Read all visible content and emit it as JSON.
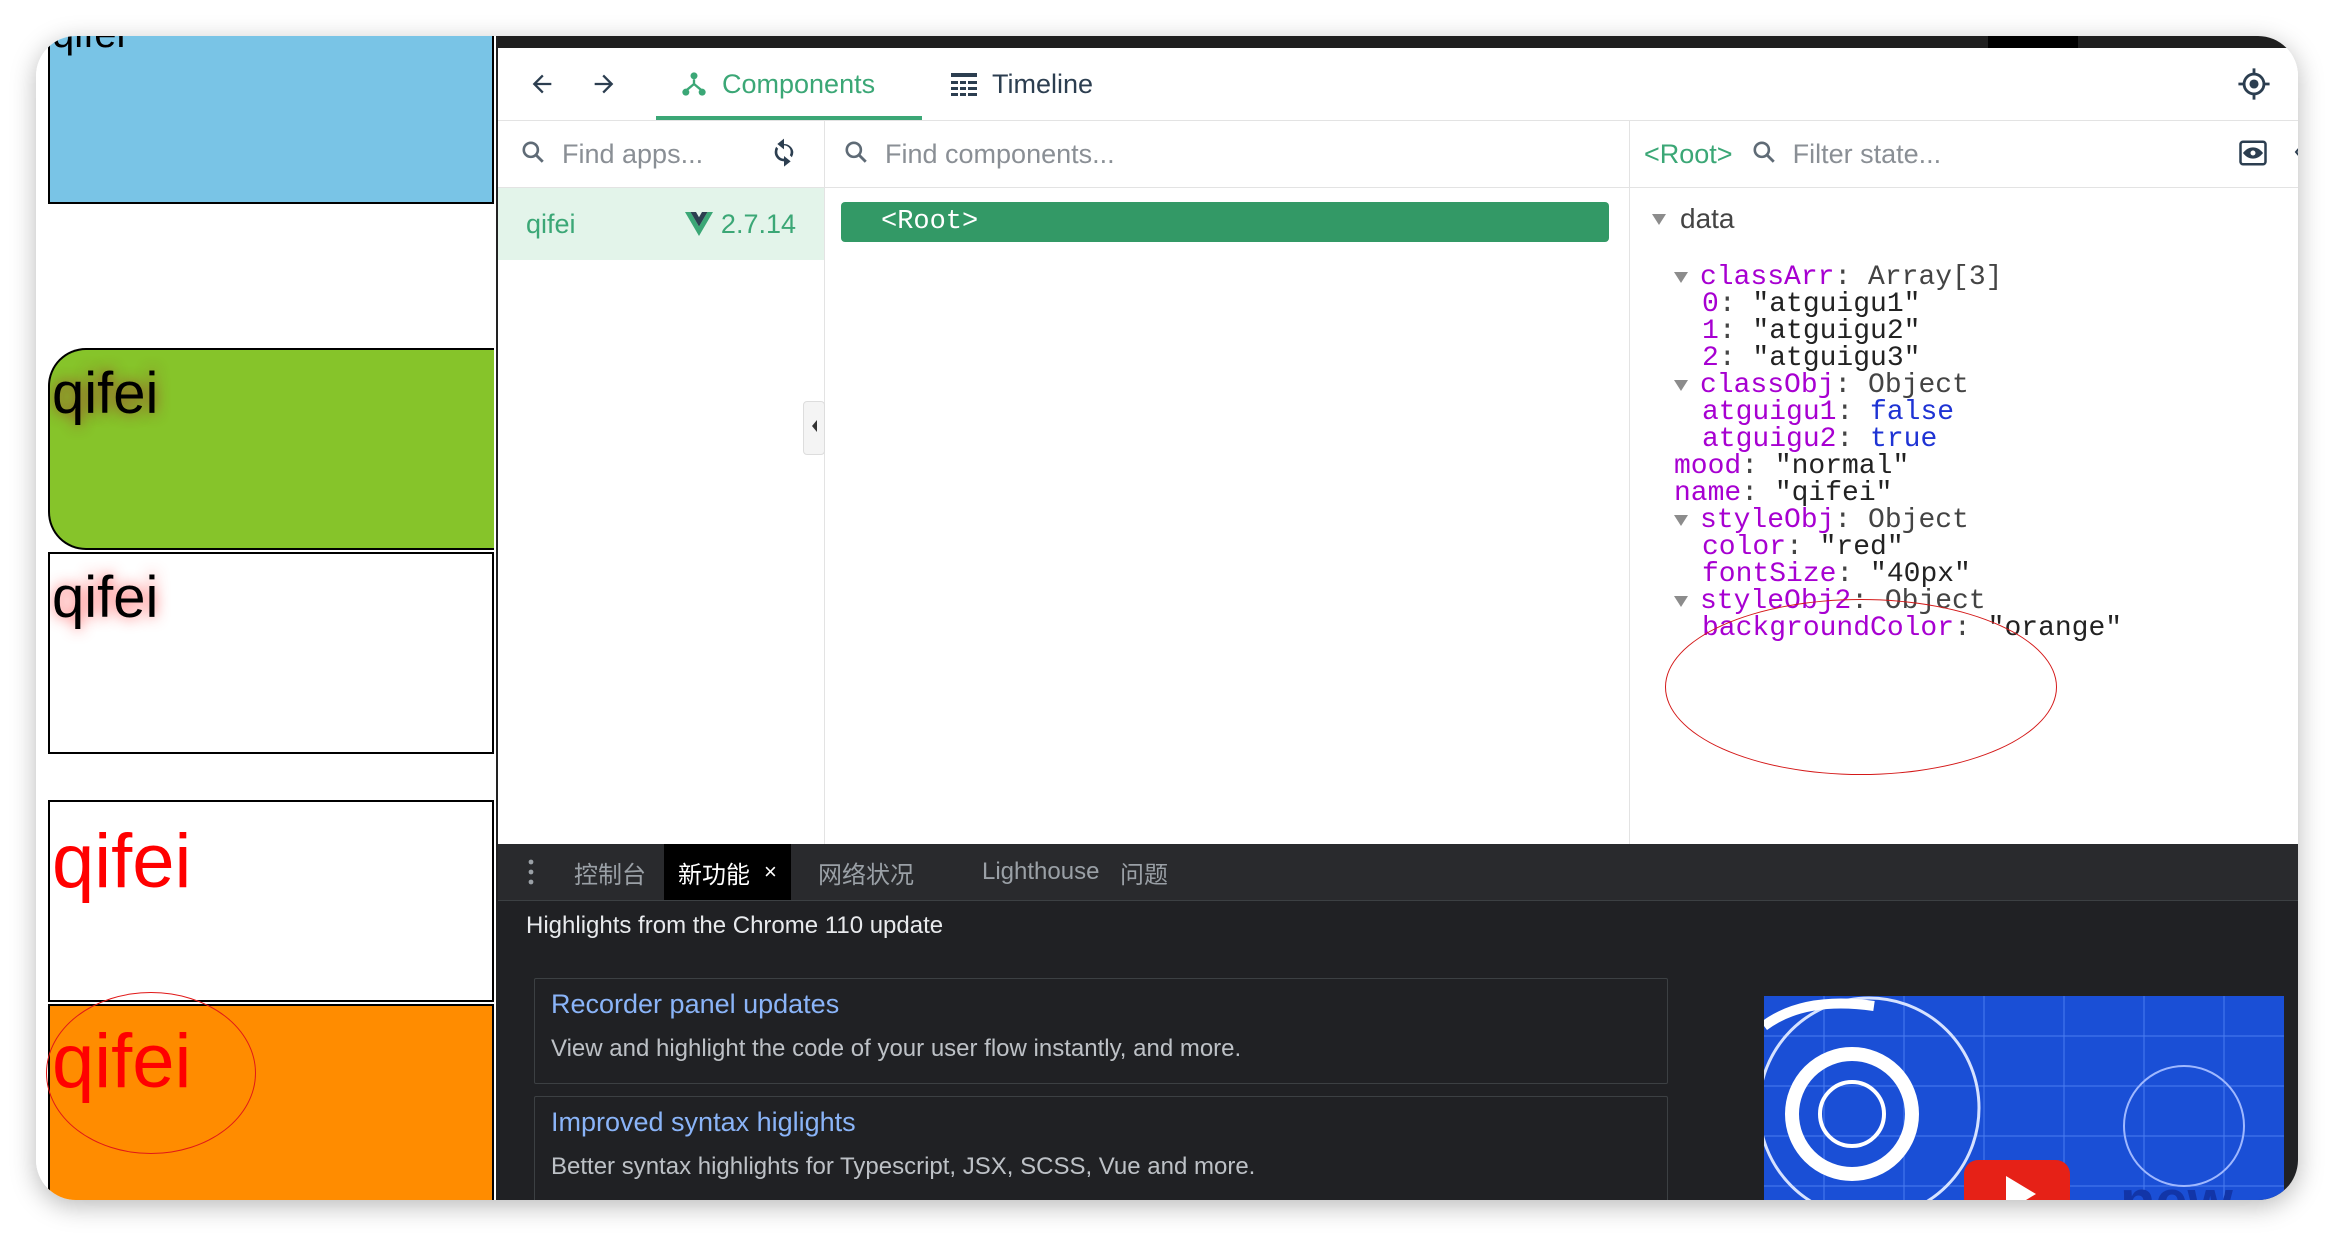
{
  "page": {
    "box1_text": "qifei",
    "box2_text": "qifei",
    "box3_text": "qifei",
    "box4_text": "qifei",
    "box5_text": "qifei",
    "colors": {
      "box1": "#79c4e6",
      "box2": "#86c42a",
      "box5": "#ff8c00",
      "text_red": "#ff0000"
    }
  },
  "devtools": {
    "nav": {
      "back_icon": "arrow-left-icon",
      "forward_icon": "arrow-right-icon",
      "tabs": [
        {
          "label": "Components",
          "icon": "components-tree-icon",
          "active": true
        },
        {
          "label": "Timeline",
          "icon": "timeline-icon",
          "active": false
        }
      ],
      "inspect_icon": "target-icon"
    },
    "apps": {
      "search_placeholder": "Find apps...",
      "refresh_icon": "refresh-icon",
      "list": [
        {
          "name": "qifei",
          "version": "2.7.14",
          "logo": "vue-logo-icon"
        }
      ]
    },
    "components": {
      "search_placeholder": "Find components...",
      "tree": [
        {
          "label": "<Root>",
          "selected": true
        }
      ]
    },
    "state": {
      "selected_tag": "<Root>",
      "filter_placeholder": "Filter state...",
      "section": "data",
      "fields": {
        "classArr": {
          "key": "classArr",
          "type": "Array[3]",
          "items": [
            {
              "index": "0",
              "value": "\"atguigu1\""
            },
            {
              "index": "1",
              "value": "\"atguigu2\""
            },
            {
              "index": "2",
              "value": "\"atguigu3\""
            }
          ]
        },
        "classObj": {
          "key": "classObj",
          "type": "Object",
          "entries": [
            {
              "key": "atguigu1",
              "value": "false"
            },
            {
              "key": "atguigu2",
              "value": "true"
            }
          ]
        },
        "mood": {
          "key": "mood",
          "value": "\"normal\""
        },
        "name": {
          "key": "name",
          "value": "\"qifei\""
        },
        "styleObj": {
          "key": "styleObj",
          "type": "Object",
          "entries": [
            {
              "key": "color",
              "value": "\"red\""
            },
            {
              "key": "fontSize",
              "value": "\"40px\""
            }
          ]
        },
        "styleObj2": {
          "key": "styleObj2",
          "type": "Object",
          "entries": [
            {
              "key": "backgroundColor",
              "value": "\"orange\""
            }
          ]
        }
      }
    },
    "colors": {
      "accent": "#3ba776",
      "key": "#a700d1",
      "bool": "#1e33d4"
    }
  },
  "drawer": {
    "tabs": [
      {
        "label": "控制台",
        "active": false
      },
      {
        "label": "新功能",
        "active": true
      },
      {
        "label": "网络状况",
        "active": false
      },
      {
        "label": "Lighthouse",
        "active": false
      },
      {
        "label": "问题",
        "active": false
      }
    ],
    "close_glyph": "×",
    "headline": "Highlights from the Chrome 110 update",
    "cards": [
      {
        "title": "Recorder panel updates",
        "desc": "View and highlight the code of your user flow instantly, and more."
      },
      {
        "title": "Improved syntax higlights",
        "desc": "Better syntax highlights for Typescript, JSX, SCSS, Vue and more."
      }
    ],
    "promo_text": "new"
  }
}
